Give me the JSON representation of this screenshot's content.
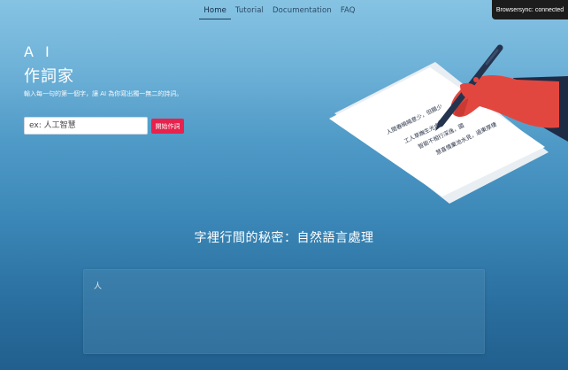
{
  "nav": {
    "items": [
      {
        "label": "Home",
        "active": true
      },
      {
        "label": "Tutorial",
        "active": false
      },
      {
        "label": "Documentation",
        "active": false
      },
      {
        "label": "FAQ",
        "active": false
      }
    ]
  },
  "browsersync": {
    "label": "Browsersync: connected"
  },
  "hero": {
    "title_line1": "A I",
    "title_line2": "作詞家",
    "subtitle": "輸入每一句的第一個字，讓 AI 為你寫出獨一無二的詩詞。",
    "input_placeholder": "ex: 人工智慧",
    "button_label": "開始作詞"
  },
  "illustration": {
    "poem_lines": [
      "人間春曉曉意少，但願少",
      "工人草嫵生光處",
      "智能不相行深逸，國",
      "慧喜情棄池水見，過東厚棲"
    ]
  },
  "section": {
    "title": "字裡行間的秘密：自然語言處理",
    "panel_char": "人"
  },
  "colors": {
    "accent": "#e8224c",
    "hand": "#e2473f",
    "pen": "#24344f"
  }
}
